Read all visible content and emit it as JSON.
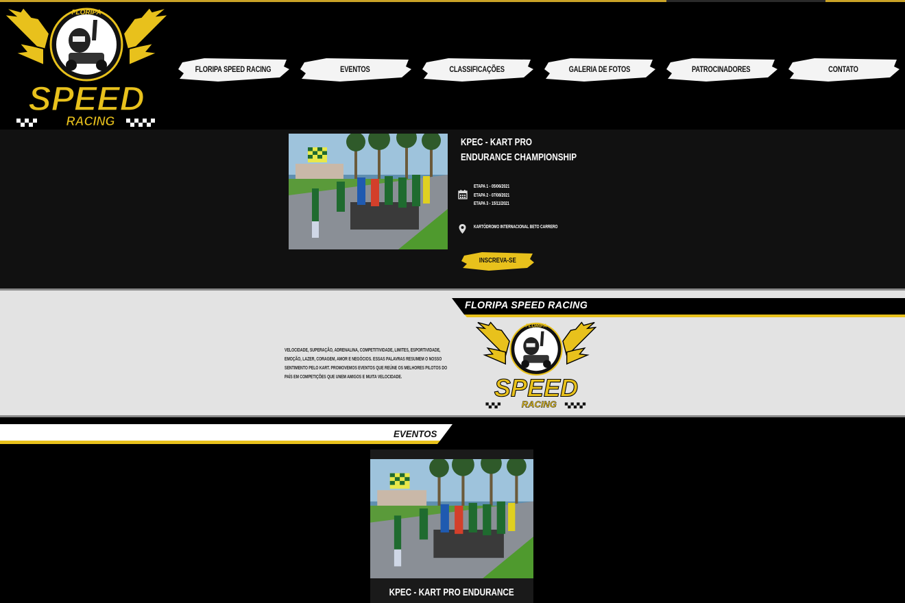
{
  "brand": {
    "logo_top": "FLORIPA",
    "logo_main": "SPEED",
    "logo_sub": "RACING",
    "gold": "#e8c11c",
    "dark": "#000000"
  },
  "nav": {
    "items": [
      {
        "label": "FLORIPA SPEED RACING"
      },
      {
        "label": "EVENTOS"
      },
      {
        "label": "CLASSIFICAÇÕES"
      },
      {
        "label": "GALERIA DE FOTOS"
      },
      {
        "label": "PATROCINADORES"
      },
      {
        "label": "CONTATO"
      }
    ]
  },
  "featured_event": {
    "title": "KPEC - KART PRO ENDURANCE CHAMPIONSHIP",
    "stages": [
      "ETAPA 1 - 05/06/2021",
      "ETAPA 2 - 07/08/2021",
      "ETAPA 3 - 15/11/2021"
    ],
    "venue": "KARTÓDROMO INTERNACIONAL BETO CARRERO",
    "cta_label": "INSCREVA-SE",
    "calendar_icon": "calendar-icon",
    "location_icon": "map-pin-icon"
  },
  "about": {
    "title": "FLORIPA SPEED RACING",
    "text": "VELOCIDADE, SUPERAÇÃO, ADRENALINA, COMPETITIVIDADE, LIMITES, ESPORTIVIDADE, EMOÇÃO, LAZER, CORAGEM, AMOR E NEGÓCIOS. ESSAS PALAVRAS RESUMEM O NOSSO SENTIMENTO PELO KART. PROMOVEMOS EVENTOS QUE REÚNE OS MELHORES PILOTOS DO PAÍS EM COMPETIÇÕES QUE UNEM AMIGOS E MUITA VELOCIDADE."
  },
  "events": {
    "title": "EVENTOS",
    "cards": [
      {
        "title": "KPEC - KART PRO ENDURANCE"
      }
    ]
  }
}
